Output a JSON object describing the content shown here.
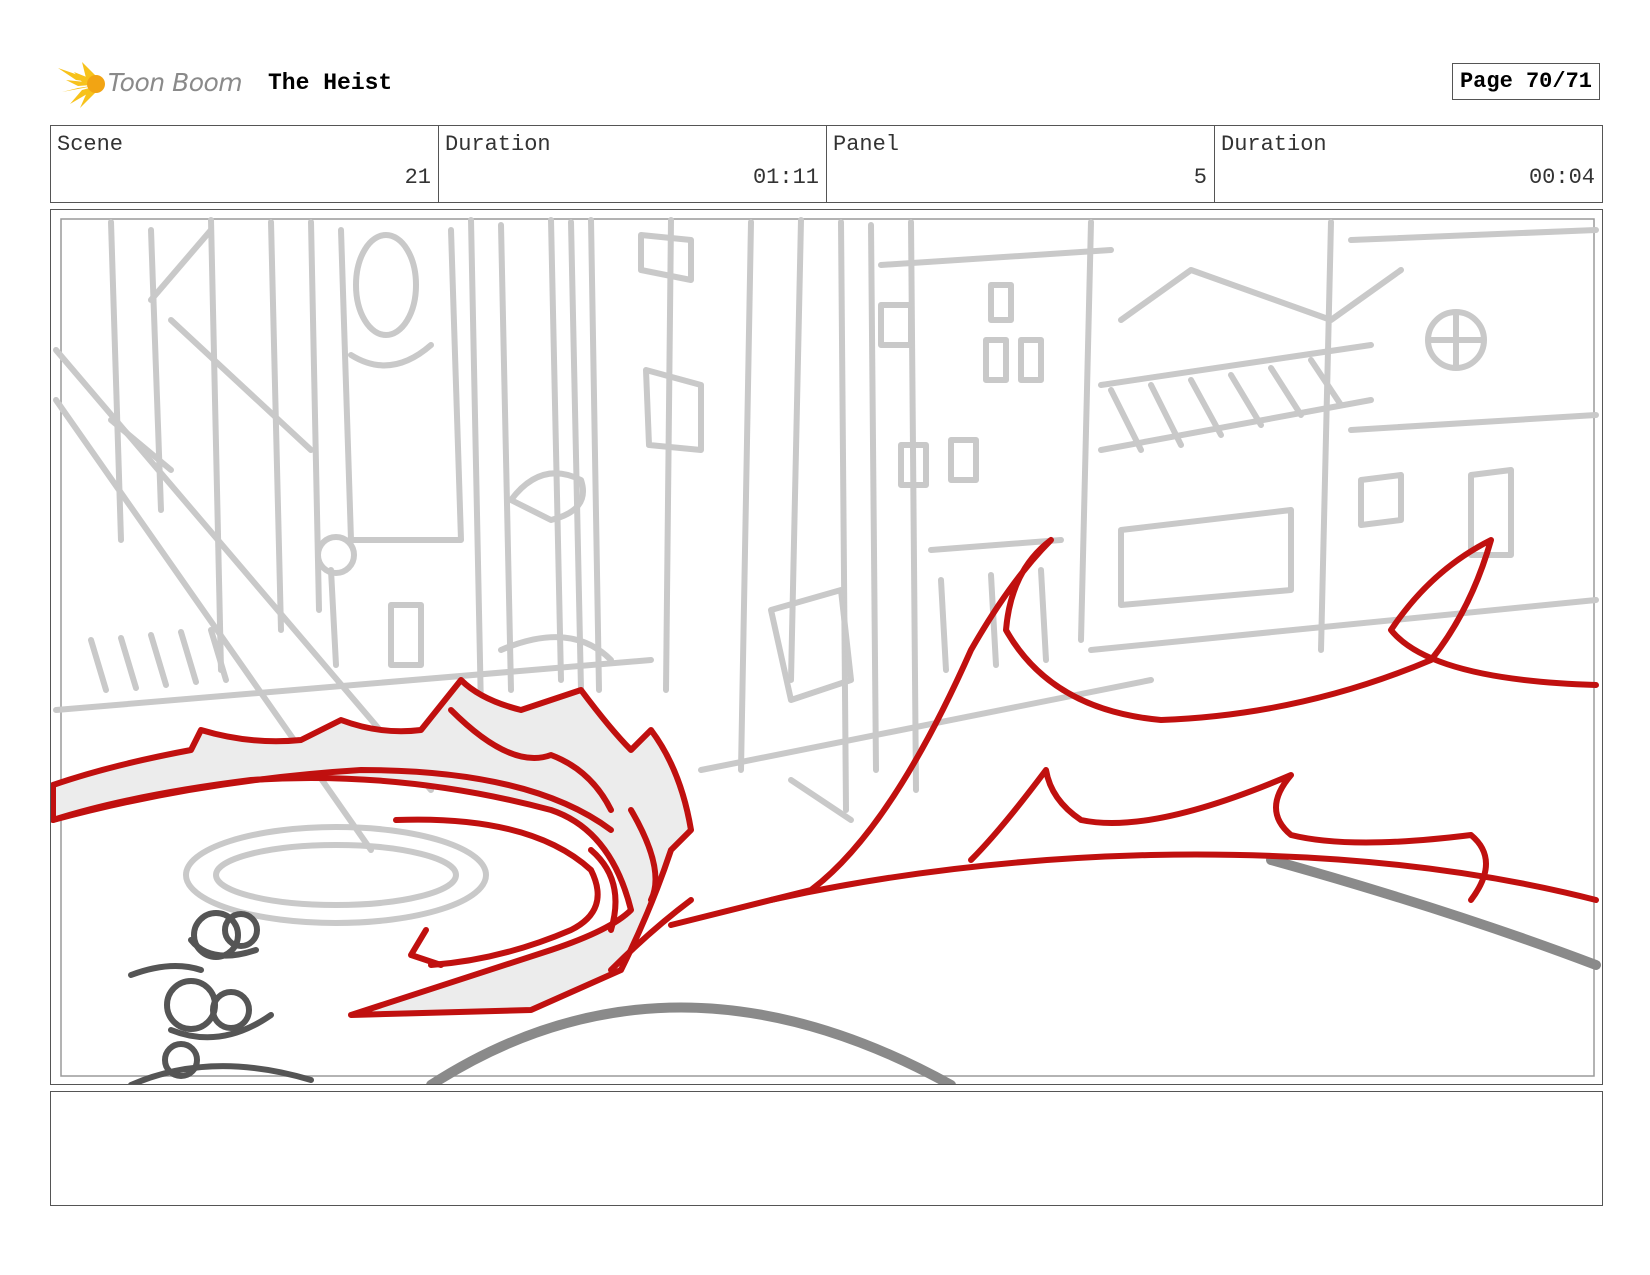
{
  "header": {
    "logo_text": "Toon Boom",
    "project_title": "The Heist",
    "page_label": "Page 70/71"
  },
  "info": {
    "scene_label": "Scene",
    "scene_value": "21",
    "scene_duration_label": "Duration",
    "scene_duration_value": "01:11",
    "panel_label": "Panel",
    "panel_value": "5",
    "panel_duration_label": "Duration",
    "panel_duration_value": "00:04"
  },
  "notes": {
    "text": ""
  },
  "colors": {
    "sketch_gray": "#c9c9c9",
    "motion_red": "#c0100f",
    "logo_yellow": "#f7c21b"
  }
}
